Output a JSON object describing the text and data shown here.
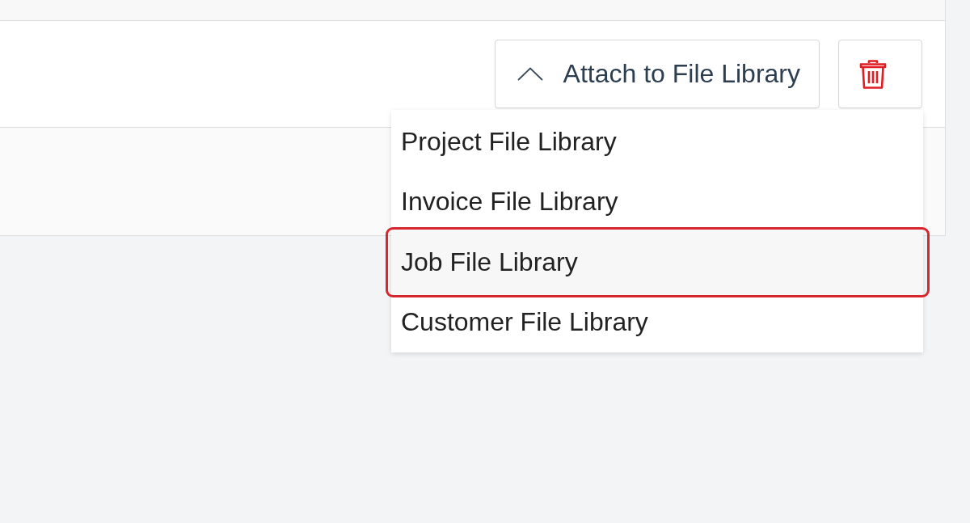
{
  "attach_button": {
    "label": "Attach to File Library",
    "expanded": true
  },
  "menu": {
    "items": [
      {
        "label": "Project File Library",
        "selected": false,
        "annotated": false
      },
      {
        "label": "Invoice File Library",
        "selected": false,
        "annotated": false
      },
      {
        "label": "Job File Library",
        "selected": true,
        "annotated": true
      },
      {
        "label": "Customer File Library",
        "selected": false,
        "annotated": false
      }
    ]
  }
}
